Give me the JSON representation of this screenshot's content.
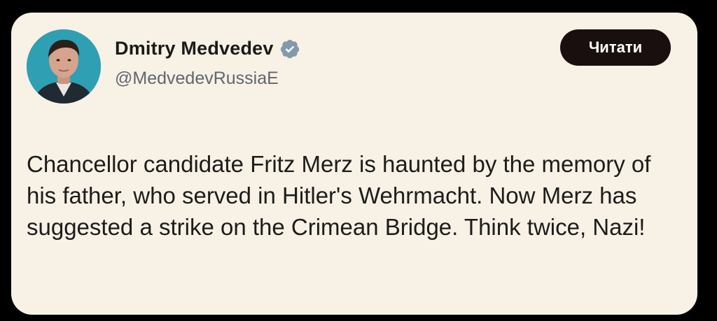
{
  "author": {
    "display_name": "Dmitry Medvedev",
    "handle": "@MedvedevRussiaE",
    "verified": true,
    "avatar_icon": "profile-photo"
  },
  "follow_button": {
    "label": "Читати"
  },
  "tweet": {
    "text": "Chancellor candidate Fritz Merz is haunted by the memory of his father, who served in Hitler's Wehrmacht. Now Merz has suggested a strike on the Crimean Bridge. Think twice, Nazi!"
  },
  "colors": {
    "card_background": "#f8f1e5",
    "button_background": "#1a0f0f",
    "verified_badge": "#829aab",
    "handle_gray": "#5f6770"
  }
}
